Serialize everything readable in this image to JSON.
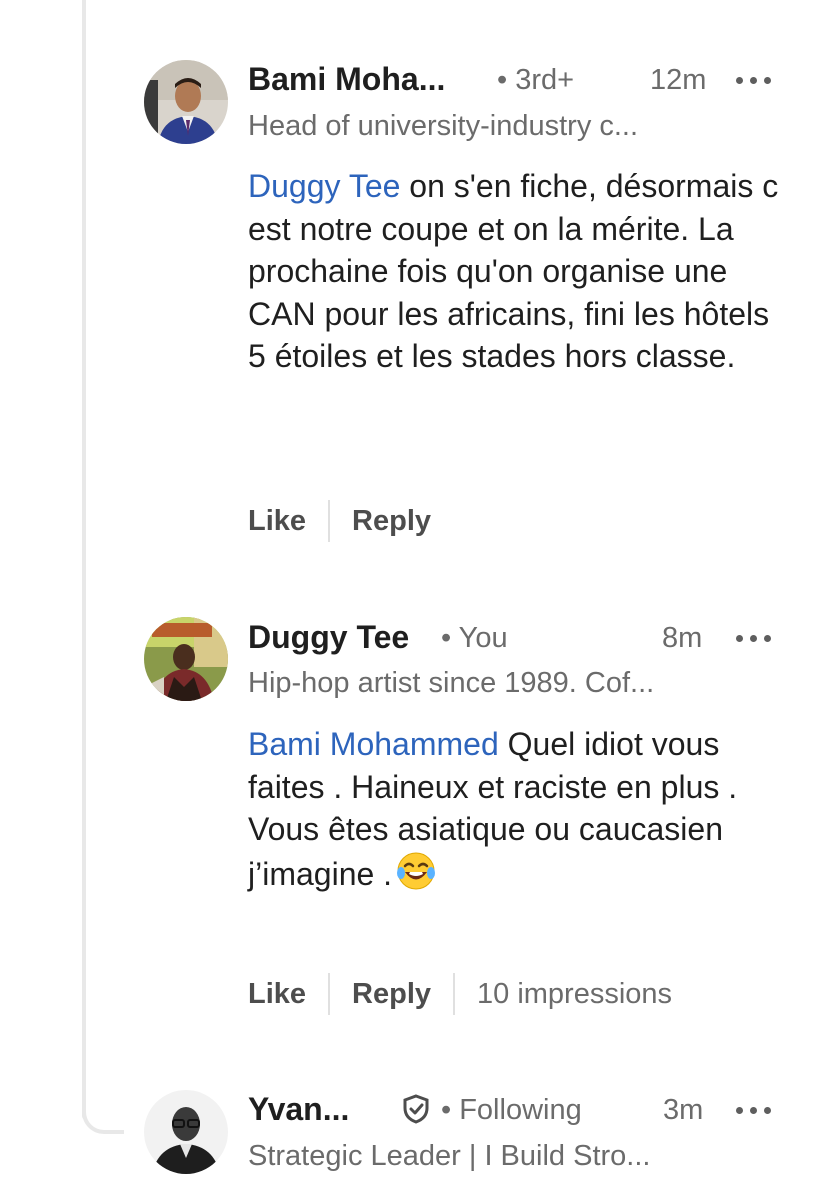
{
  "comments": [
    {
      "author": "Bami Moha...",
      "meta": "• 3rd+",
      "time": "12m",
      "headline": "Head of university-industry c...",
      "mention": "Duggy Tee",
      "text": " on s'en fiche, désormais c est notre coupe et on la mérite. La prochaine fois qu'on organise une CAN pour les africains, fini les hôtels 5 étoiles et les stades hors classe.",
      "like_label": "Like",
      "reply_label": "Reply"
    },
    {
      "author": "Duggy Tee",
      "meta": "• You",
      "time": "8m",
      "headline": "Hip-hop artist since 1989. Cof...",
      "mention": "Bami Mohammed",
      "line1": " Quel idiot vous faites . Haineux et raciste en plus .",
      "line2": "Vous êtes asiatique ou caucasien j’imagine .",
      "emoji": "face-with-tears-of-joy",
      "like_label": "Like",
      "reply_label": "Reply",
      "impressions": "10 impressions"
    },
    {
      "author": "Yvan...",
      "meta": "• Following",
      "time": "3m",
      "headline": "Strategic Leader | I Build Stro...",
      "badge_icon": "verified-shield-icon"
    }
  ],
  "colors": {
    "mention": "#2d64bc",
    "text": "#1f1f1f",
    "secondary": "#6b6b6b"
  }
}
